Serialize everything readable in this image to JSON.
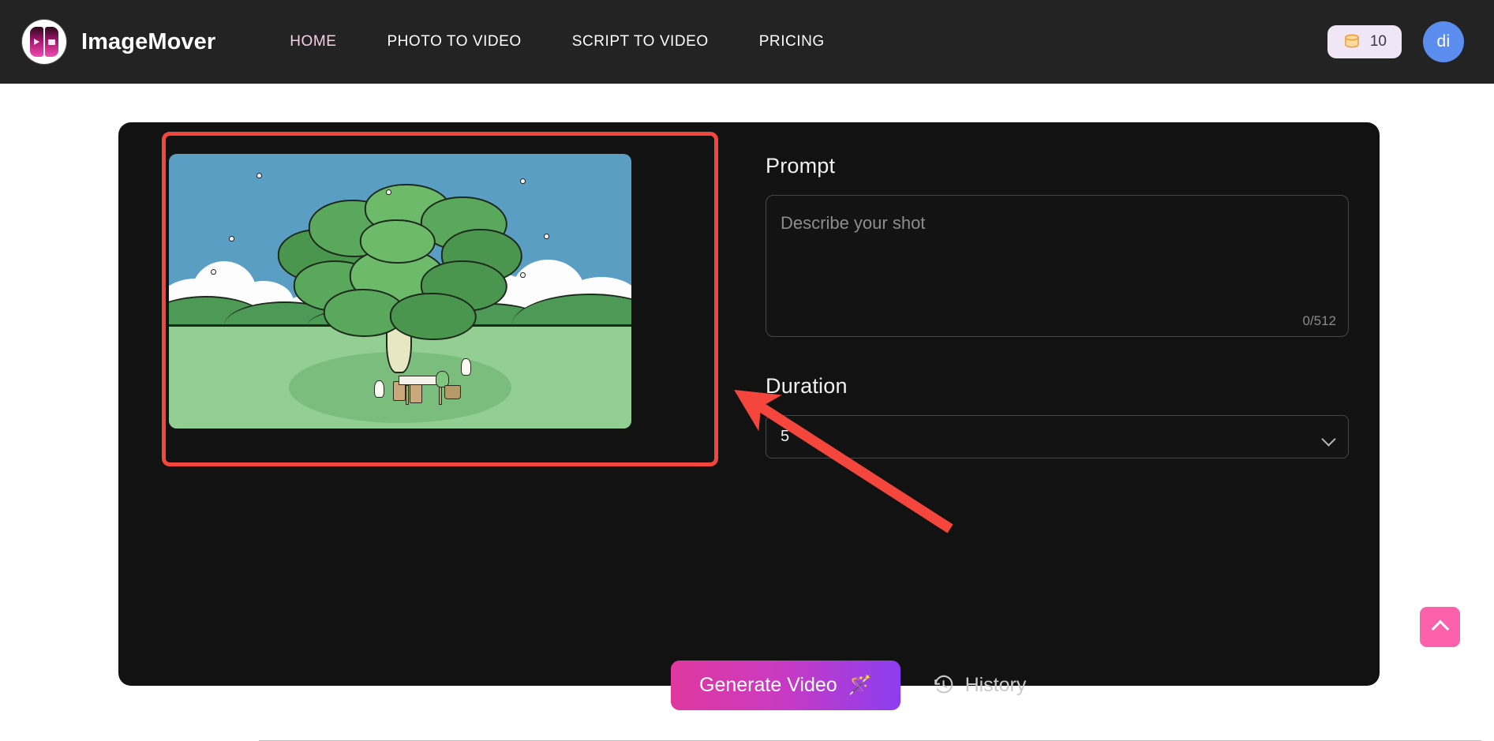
{
  "navbar": {
    "brand_name": "ImageMover",
    "logo_icon": "imagemover-logo-icon",
    "links": [
      {
        "label": "HOME",
        "active": true
      },
      {
        "label": "PHOTO TO VIDEO",
        "active": false
      },
      {
        "label": "SCRIPT TO VIDEO",
        "active": false
      },
      {
        "label": "PRICING",
        "active": false
      }
    ],
    "credits": {
      "icon": "coin-stack-icon",
      "count": "10"
    },
    "avatar": {
      "initials": "di",
      "color": "#5b8def"
    }
  },
  "main": {
    "preview": {
      "alt": "illustration of a large green tree over a grassy field with a picnic",
      "highlight_color": "#f4463c"
    },
    "prompt": {
      "label": "Prompt",
      "value": "",
      "placeholder": "Describe your shot",
      "counter": "0/512"
    },
    "duration": {
      "label": "Duration",
      "value": "5",
      "chevron_icon": "chevron-down-icon"
    },
    "actions": {
      "generate_label": "Generate Video",
      "generate_icon": "magic-wand-icon",
      "history_label": "History",
      "history_icon": "clock-rewind-icon"
    }
  },
  "scroll_top": {
    "icon": "chevron-up-icon",
    "color": "#fb62ab"
  },
  "annotation": {
    "type": "arrow",
    "color": "#f4463c"
  }
}
